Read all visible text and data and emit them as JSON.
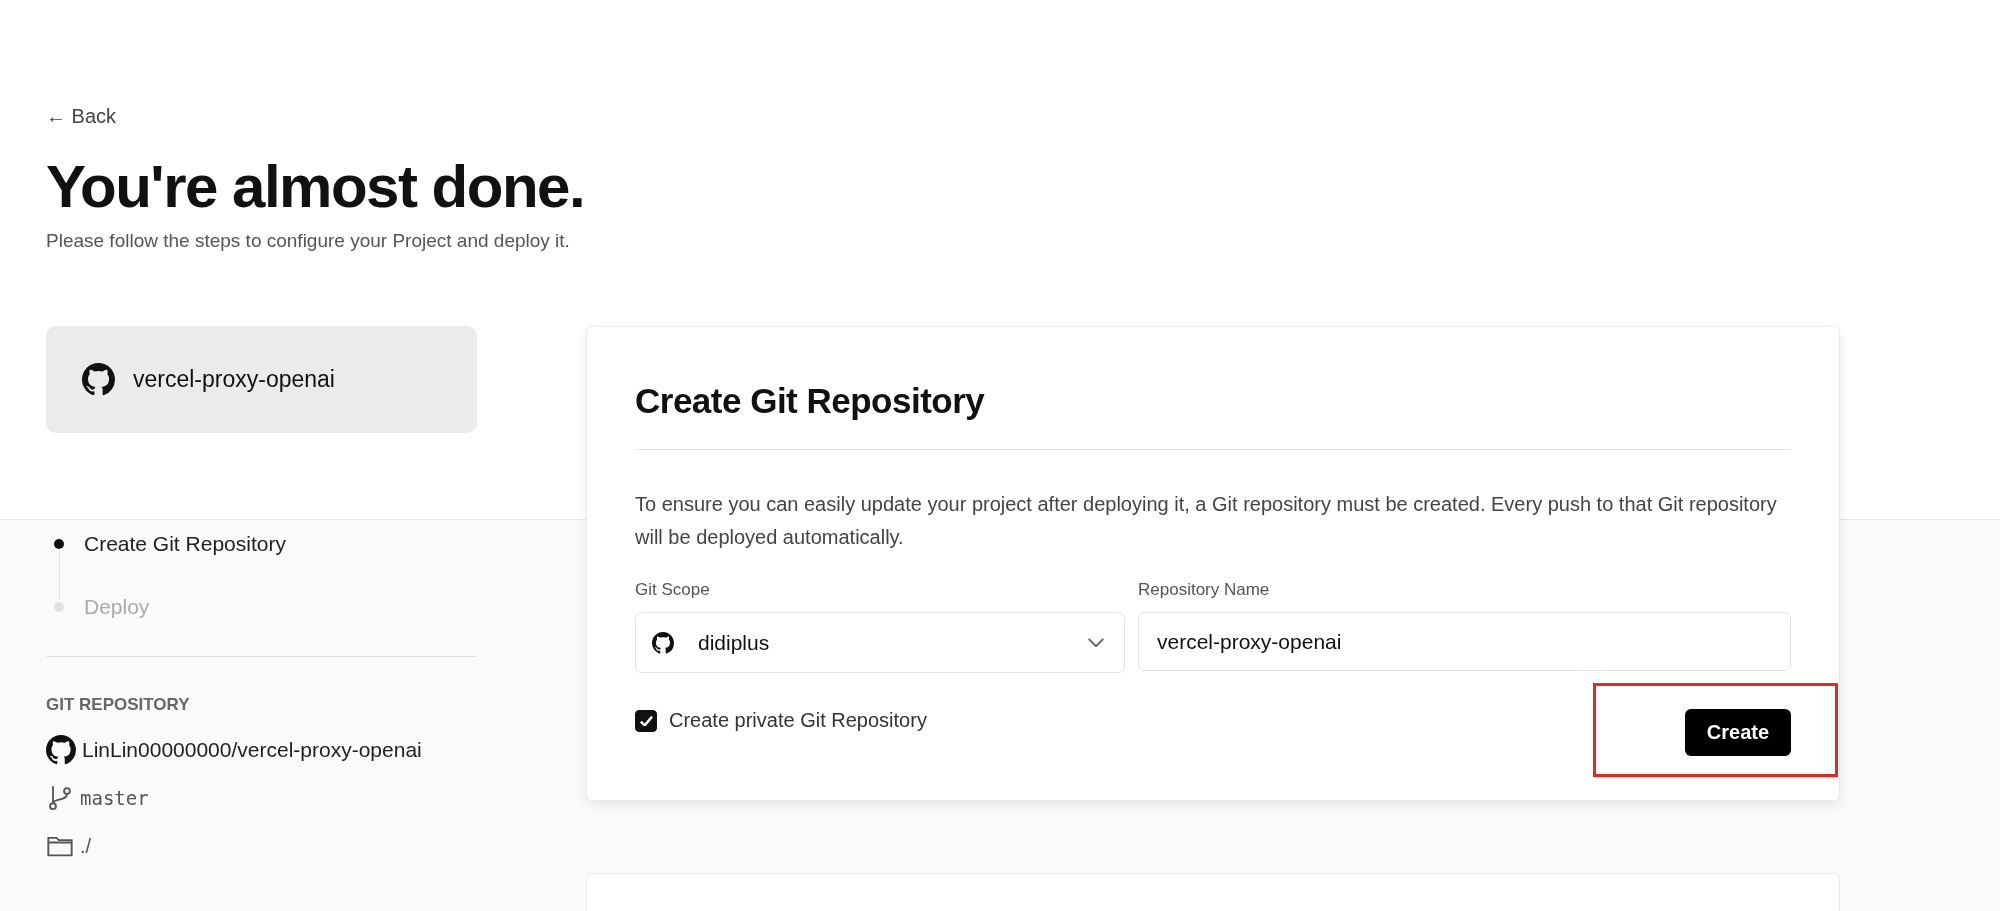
{
  "back_link": "← Back",
  "title": "You're almost done.",
  "subtitle": "Please follow the steps to configure your Project and deploy it.",
  "project": {
    "name": "vercel-proxy-openai"
  },
  "steps": [
    {
      "label": "Create Git Repository",
      "active": true
    },
    {
      "label": "Deploy",
      "active": false
    }
  ],
  "git_repository": {
    "heading": "GIT REPOSITORY",
    "repo": "LinLin00000000/vercel-proxy-openai",
    "branch": "master",
    "directory": "./"
  },
  "card": {
    "title": "Create Git Repository",
    "description": "To ensure you can easily update your project after deploying it, a Git repository must be created. Every push to that Git repository will be deployed automatically.",
    "scope_label": "Git Scope",
    "scope_value": "didiplus",
    "name_label": "Repository Name",
    "name_value": "vercel-proxy-openai",
    "private_checkbox": {
      "label": "Create private Git Repository",
      "checked": true
    },
    "create_button": "Create"
  }
}
